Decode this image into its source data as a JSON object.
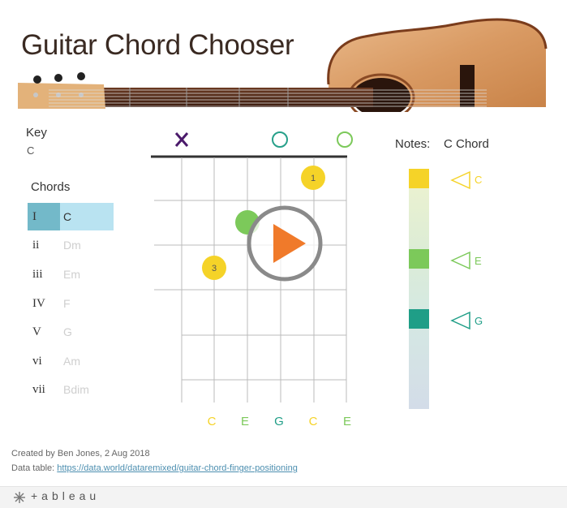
{
  "header": {
    "title": "Guitar Chord Chooser"
  },
  "key": {
    "label": "Key",
    "value": "C"
  },
  "chords": {
    "label": "Chords",
    "selected_index": 0,
    "items": [
      {
        "numeral": "I",
        "name": "C"
      },
      {
        "numeral": "ii",
        "name": "Dm"
      },
      {
        "numeral": "iii",
        "name": "Em"
      },
      {
        "numeral": "IV",
        "name": "F"
      },
      {
        "numeral": "V",
        "name": "G"
      },
      {
        "numeral": "vi",
        "name": "Am"
      },
      {
        "numeral": "vii",
        "name": "Bdim"
      }
    ]
  },
  "fretboard": {
    "open_markers": [
      "muted",
      "none",
      "none",
      "open",
      "none",
      "open"
    ],
    "finger_labels": [
      "1",
      "3"
    ],
    "string_notes": [
      {
        "note": "C",
        "color": "#f5d328"
      },
      {
        "note": "E",
        "color": "#7cc95a"
      },
      {
        "note": "G",
        "color": "#1f9e87"
      },
      {
        "note": "C",
        "color": "#f5d328"
      },
      {
        "note": "E",
        "color": "#7cc95a"
      }
    ]
  },
  "notes_panel": {
    "label": "Notes:",
    "chord_name": "C Chord",
    "notes": [
      {
        "note": "C",
        "color": "#f5d328"
      },
      {
        "note": "E",
        "color": "#7cc95a"
      },
      {
        "note": "G",
        "color": "#1f9e87"
      }
    ]
  },
  "footer": {
    "credit": "Created by Ben Jones, 2 Aug 2018",
    "data_table_label": "Data table:",
    "data_table_link": "https://data.world/dataremixed/guitar-chord-finger-positioning",
    "brand": "+ableau"
  },
  "colors": {
    "selected_numeral_bg": "#73b9c9",
    "selected_name_bg": "#b9e3f1",
    "muted_x": "#4b1a6b",
    "open_circle": "#27a08a",
    "play_orange": "#f07a2a"
  }
}
